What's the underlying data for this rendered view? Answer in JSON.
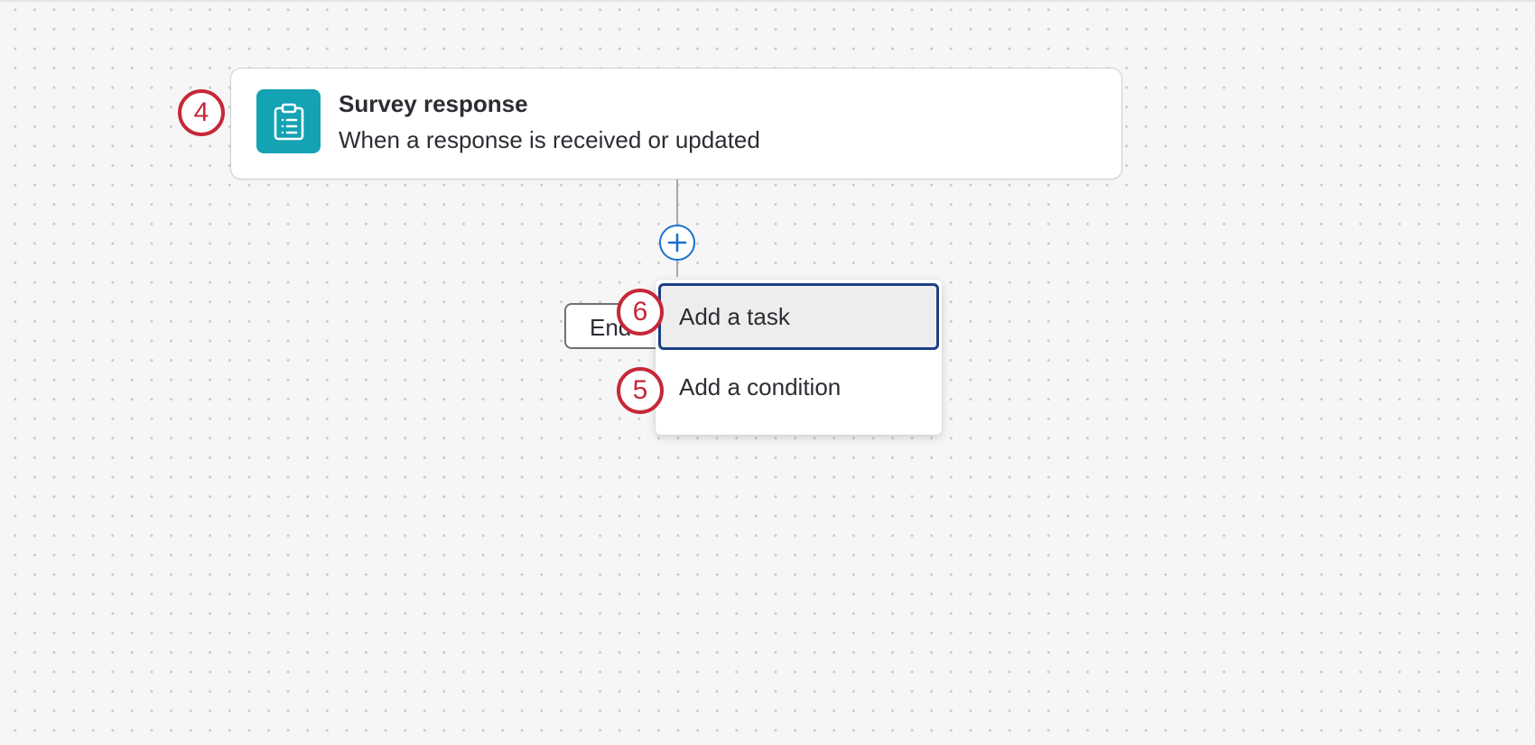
{
  "trigger": {
    "title": "Survey response",
    "subtitle": "When a response is received or updated",
    "icon": "clipboard-list-icon"
  },
  "add_step": {
    "icon": "plus-circle-icon"
  },
  "end_node": {
    "label": "End"
  },
  "add_menu": {
    "items": [
      {
        "label": "Add a task"
      },
      {
        "label": "Add a condition"
      }
    ]
  },
  "annotations": {
    "trigger_step": "4",
    "task_step": "6",
    "condition_step": "5"
  },
  "colors": {
    "trigger_icon_bg": "#13a3b3",
    "add_button_blue": "#1a6fd1",
    "focus_border": "#1b3f85",
    "annotation_red": "#c62838"
  }
}
